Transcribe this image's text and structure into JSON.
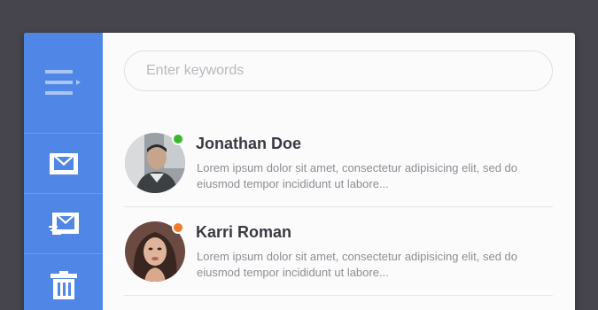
{
  "search": {
    "placeholder": "Enter keywords"
  },
  "sidebar": {
    "items": [
      {
        "name": "menu",
        "icon": "hamburger-menu-icon"
      },
      {
        "name": "inbox",
        "icon": "envelope-icon"
      },
      {
        "name": "sent",
        "icon": "envelope-send-icon"
      },
      {
        "name": "trash",
        "icon": "trash-icon"
      }
    ]
  },
  "messages": [
    {
      "sender": "Jonathan Doe",
      "preview": "Lorem ipsum dolor sit amet, consectetur adipisicing elit, sed do eiusmod tempor incididunt ut labore...",
      "status_color": "#3bb72f"
    },
    {
      "sender": "Karri Roman",
      "preview": "Lorem ipsum dolor sit amet, consectetur adipisicing elit, sed do eiusmod tempor incididunt ut labore...",
      "status_color": "#f07a2a"
    }
  ],
  "colors": {
    "sidebar": "#5087e6",
    "background": "#46454d",
    "panel": "#fbfbfb"
  }
}
